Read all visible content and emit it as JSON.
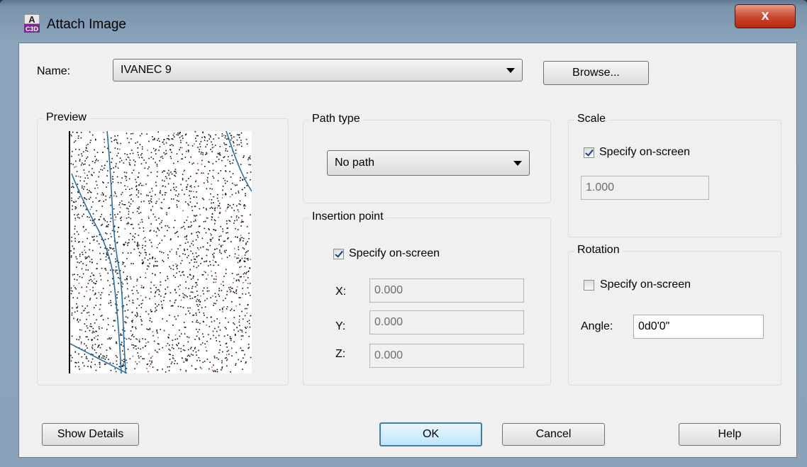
{
  "window": {
    "title": "Attach Image",
    "close_glyph": "x"
  },
  "name": {
    "label": "Name:",
    "value": "IVANEC 9",
    "browse_label": "Browse..."
  },
  "preview": {
    "title": "Preview"
  },
  "path_type": {
    "title": "Path type",
    "value": "No path"
  },
  "insertion_point": {
    "title": "Insertion point",
    "specify_label": "Specify on-screen",
    "specify_checked": true,
    "x_label": "X:",
    "x_value": "0.000",
    "y_label": "Y:",
    "y_value": "0.000",
    "z_label": "Z:",
    "z_value": "0.000"
  },
  "scale": {
    "title": "Scale",
    "specify_label": "Specify on-screen",
    "specify_checked": true,
    "value": "1.000"
  },
  "rotation": {
    "title": "Rotation",
    "specify_label": "Specify on-screen",
    "specify_checked": false,
    "angle_label": "Angle:",
    "angle_value": "0d0'0\""
  },
  "buttons": {
    "show_details": "Show Details",
    "ok": "OK",
    "cancel": "Cancel",
    "help": "Help"
  },
  "colors": {
    "accent": "#3c7fb1",
    "close": "#c8452b",
    "map_line": "#2a6fa8"
  }
}
